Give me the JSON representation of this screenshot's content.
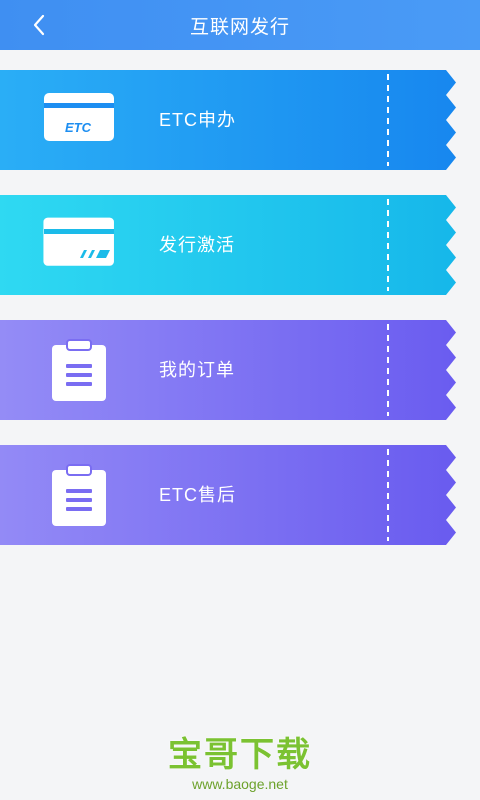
{
  "header": {
    "title": "互联网发行",
    "back_icon": "chevron-left-icon"
  },
  "cards": [
    {
      "label": "ETC申办",
      "icon": "etc-card-icon",
      "gradient": [
        "#1fa8f5",
        "#1a88f0"
      ],
      "icon_text": "ETC"
    },
    {
      "label": "发行激活",
      "icon": "card-activate-icon",
      "gradient": [
        "#25d3ef",
        "#17b9ea"
      ]
    },
    {
      "label": "我的订单",
      "icon": "clipboard-icon",
      "gradient": [
        "#8c84f5",
        "#6b5cf0"
      ]
    },
    {
      "label": "ETC售后",
      "icon": "clipboard-icon",
      "gradient": [
        "#8b7ff5",
        "#6a5bef"
      ]
    }
  ],
  "watermark": {
    "main": "宝哥下载",
    "url": "www.baoge.net"
  }
}
